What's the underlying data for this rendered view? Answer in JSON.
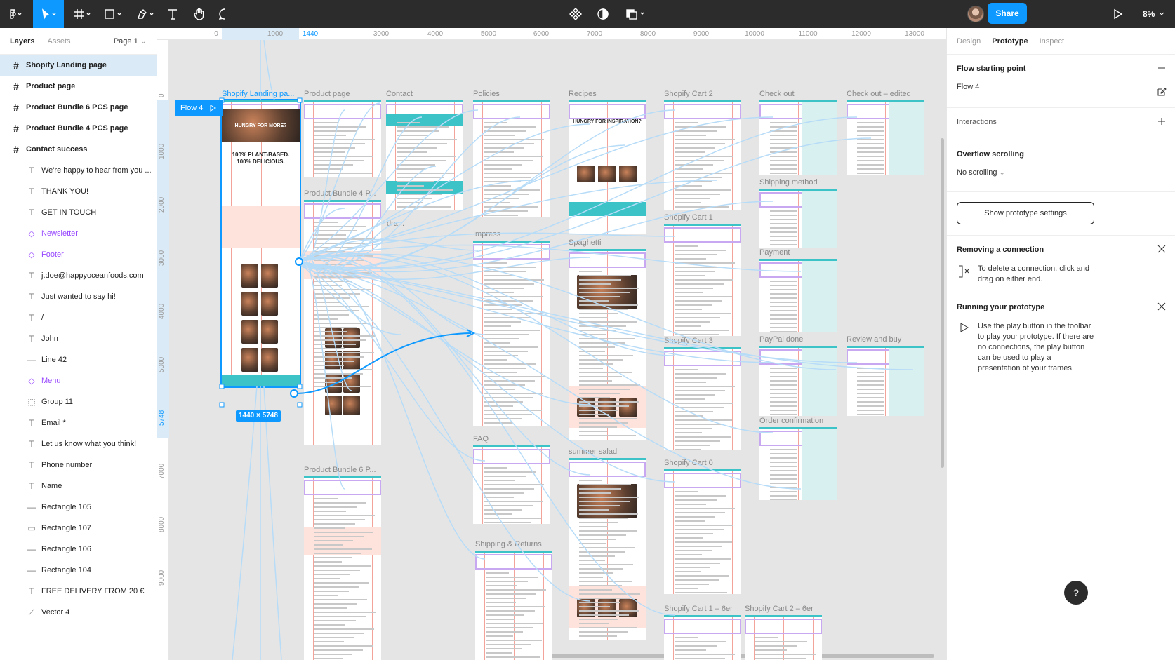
{
  "toolbar": {
    "share_label": "Share",
    "zoom": "8%",
    "icons": [
      "figma-menu-icon",
      "move-tool-icon",
      "frame-tool-icon",
      "shape-tool-icon",
      "pen-tool-icon",
      "text-tool-icon",
      "hand-tool-icon",
      "comment-tool-icon",
      "components-icon",
      "theme-toggle-icon",
      "multiplayer-icon",
      "play-icon"
    ]
  },
  "left_panel": {
    "tabs": [
      "Layers",
      "Assets"
    ],
    "page": "Page 1",
    "layers": [
      {
        "name": "Shopify Landing page",
        "type": "frame",
        "level": "top",
        "selected": true
      },
      {
        "name": "Product page",
        "type": "frame",
        "level": "top"
      },
      {
        "name": "Product Bundle 6 PCS page",
        "type": "frame",
        "level": "top"
      },
      {
        "name": "Product Bundle 4 PCS page",
        "type": "frame",
        "level": "top"
      },
      {
        "name": "Contact success",
        "type": "frame",
        "level": "top"
      },
      {
        "name": "We're happy to hear from you ...",
        "type": "text",
        "level": "child"
      },
      {
        "name": "THANK YOU!",
        "type": "text",
        "level": "child"
      },
      {
        "name": "GET IN TOUCH",
        "type": "text",
        "level": "child"
      },
      {
        "name": "Newsletter",
        "type": "component",
        "level": "child"
      },
      {
        "name": "Footer",
        "type": "component",
        "level": "child"
      },
      {
        "name": "j.doe@happyoceanfoods.com",
        "type": "text",
        "level": "child"
      },
      {
        "name": "Just wanted to say hi!",
        "type": "text",
        "level": "child"
      },
      {
        "name": "/",
        "type": "text",
        "level": "child"
      },
      {
        "name": "John",
        "type": "text",
        "level": "child"
      },
      {
        "name": "Line 42",
        "type": "line",
        "level": "child"
      },
      {
        "name": "Menu",
        "type": "component",
        "level": "child"
      },
      {
        "name": "Group 11",
        "type": "group",
        "level": "child"
      },
      {
        "name": "Email *",
        "type": "text",
        "level": "child"
      },
      {
        "name": "Let us know what you think!",
        "type": "text",
        "level": "child"
      },
      {
        "name": "Phone number",
        "type": "text",
        "level": "child"
      },
      {
        "name": "Name",
        "type": "text",
        "level": "child"
      },
      {
        "name": "Rectangle 105",
        "type": "line",
        "level": "child"
      },
      {
        "name": "Rectangle 107",
        "type": "rect",
        "level": "child"
      },
      {
        "name": "Rectangle 106",
        "type": "line",
        "level": "child"
      },
      {
        "name": "Rectangle 104",
        "type": "line",
        "level": "child"
      },
      {
        "name": "FREE DELIVERY FROM 20 €",
        "type": "text",
        "level": "child"
      },
      {
        "name": "Vector 4",
        "type": "vector",
        "level": "child"
      }
    ]
  },
  "rulers": {
    "top": [
      "0",
      "1000",
      "1440",
      "3000",
      "4000",
      "5000",
      "6000",
      "7000",
      "8000",
      "9000",
      "10000",
      "11000",
      "12000",
      "13000"
    ],
    "left": [
      "0",
      "1000",
      "2000",
      "3000",
      "4000",
      "5000",
      "5748",
      "7000",
      "8000",
      "9000"
    ]
  },
  "canvas": {
    "flow_badge": "Flow 4",
    "selection_size": "1440 × 5748",
    "frame_labels": [
      "Shopify Landing pa...",
      "Product page",
      "Contact",
      "Policies",
      "Recipes",
      "Shopify Cart 2",
      "Check out",
      "Check out – edited",
      "Product Bundle 4 P...",
      "Shipping method",
      "Shopify Cart 1",
      "Impress",
      "Spaghetti",
      "Payment",
      "Shopify Cart 3",
      "PayPal done",
      "Review and buy",
      "Order confirmation",
      "FAQ",
      "summer salad",
      "Shopify Cart 0",
      "Product Bundle 6 P...",
      "Shipping & Returns",
      "Shopify Cart 1 – 6er",
      "Shopify Cart 2 – 6er",
      "dra..."
    ],
    "hero_text_1": "HUNGRY FOR MORE?",
    "hero_text_2": "100% PLANT-BASED. 100% DELICIOUS.",
    "recipes_heading": "HUNGRY FOR INSPIRATION?"
  },
  "right_panel": {
    "tabs": [
      "Design",
      "Prototype",
      "Inspect"
    ],
    "flow_start_title": "Flow starting point",
    "flow_name": "Flow 4",
    "interactions_title": "Interactions",
    "overflow_title": "Overflow scrolling",
    "overflow_value": "No scrolling",
    "proto_settings_label": "Show prototype settings",
    "remove_conn_title": "Removing a connection",
    "remove_conn_text": "To delete a connection, click and drag on either end.",
    "running_title": "Running your prototype",
    "running_text": "Use the play button in the toolbar to play your prototype. If there are no connections, the play button can be used to play a presentation of your frames.",
    "help_label": "?"
  },
  "colors": {
    "accent": "#0d99ff",
    "toolbar_bg": "#2c2c2c",
    "frame_teal": "#3bc3c8",
    "component": "#9747ff",
    "connection": "#b7dcf8"
  }
}
